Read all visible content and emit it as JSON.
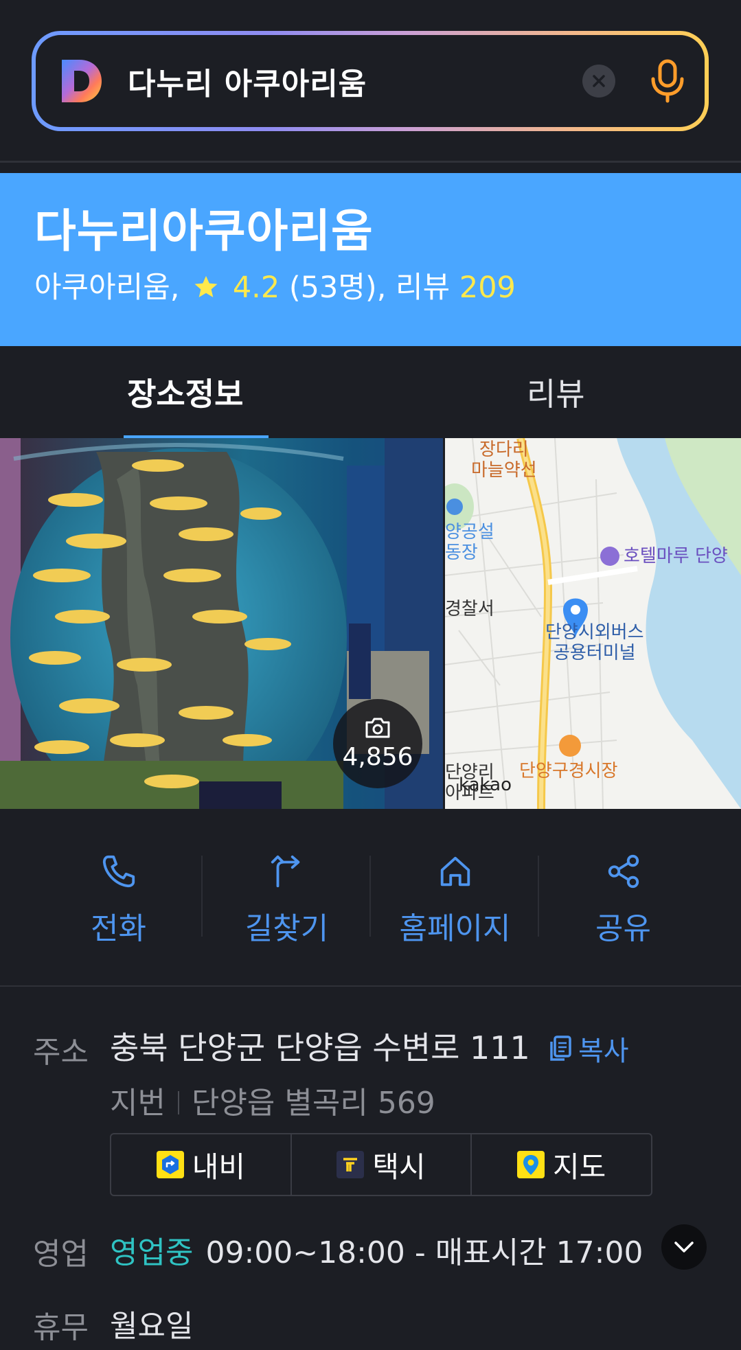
{
  "search": {
    "query": "다누리 아쿠아리움",
    "logo_icon": "daum-d-logo",
    "clear_icon": "clear-icon",
    "mic_icon": "microphone-icon"
  },
  "place": {
    "title": "다누리아쿠아리움",
    "category": "아쿠아리움,",
    "rating": "4.2",
    "rating_count": "(53명), 리뷰",
    "review_count": "209"
  },
  "tabs": [
    {
      "label": "장소정보",
      "active": true
    },
    {
      "label": "리뷰",
      "active": false
    }
  ],
  "photo": {
    "count": "4,856",
    "icon": "camera-icon"
  },
  "map": {
    "labels": {
      "pharmacy": "장다리\n마늘약선",
      "stadium": "양공설\n동장",
      "hotel": "호텔마루 단양",
      "police": "경찰서",
      "terminal": "단양시외버스\n공용터미널",
      "market": "단양구경시장",
      "apt": "단양리\n아파트",
      "brand": "kakao"
    }
  },
  "actions": [
    {
      "label": "전화",
      "icon": "phone-icon"
    },
    {
      "label": "길찾기",
      "icon": "directions-icon"
    },
    {
      "label": "홈페이지",
      "icon": "home-icon"
    },
    {
      "label": "공유",
      "icon": "share-icon"
    }
  ],
  "info": {
    "address_label": "주소",
    "address": "충북 단양군 단양읍 수변로 111",
    "copy_label": "복사",
    "jibun_label": "지번",
    "jibun": "단양읍 별곡리 569",
    "nav_buttons": [
      {
        "label": "내비",
        "icon": "navi-icon"
      },
      {
        "label": "택시",
        "icon": "taxi-icon"
      },
      {
        "label": "지도",
        "icon": "map-pin-icon"
      }
    ],
    "hours_label": "영업",
    "open_status": "영업중",
    "hours": "09:00~18:00 - 매표시간 17:00",
    "closed_label": "휴무",
    "closed_day": "월요일"
  },
  "colors": {
    "background": "#1c1e24",
    "header_blue": "#4aa6ff",
    "accent_blue": "#4e95ef",
    "rating_yellow": "#ffe94c",
    "open_teal": "#2fc3c3"
  }
}
